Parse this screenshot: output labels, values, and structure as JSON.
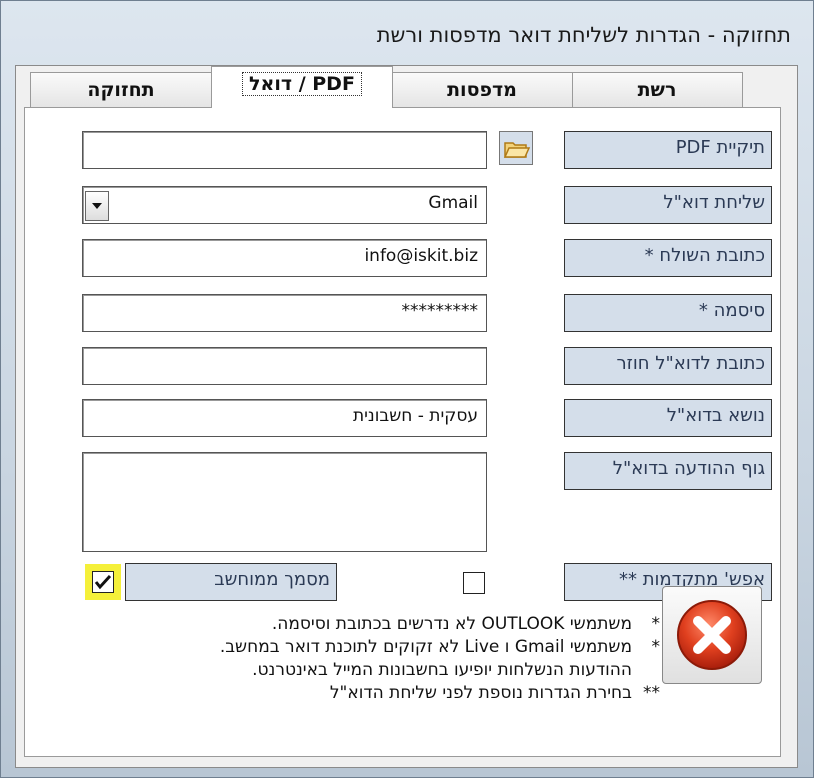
{
  "window": {
    "title": "תחזוקה - הגדרות לשליחת דואר מדפסות ורשת"
  },
  "tabs": [
    {
      "label": "רשת"
    },
    {
      "label": "מדפסות"
    },
    {
      "label": "דואל / PDF"
    },
    {
      "label": "תחזוקה"
    }
  ],
  "form": {
    "pdf_folder": {
      "label": "תיקיית PDF",
      "value": ""
    },
    "email_send": {
      "label": "שליחת דוא\"ל",
      "value": "Gmail"
    },
    "sender_address": {
      "label": "כתובת השולח *",
      "value": "info@iskit.biz"
    },
    "password": {
      "label": "סיסמה *",
      "value": "*********"
    },
    "reply_address": {
      "label": "כתובת לדוא\"ל חוזר",
      "value": ""
    },
    "subject": {
      "label": "נושא בדוא\"ל",
      "value": "עסקית - חשבונית"
    },
    "body": {
      "label": "גוף ההודעה בדוא\"ל",
      "value": ""
    },
    "advanced": {
      "label": "אפש' מתקדמות **",
      "checked": false
    },
    "computerized_doc": {
      "label": "מסמך ממוחשב",
      "checked": true
    }
  },
  "notes": [
    {
      "star": "*",
      "text": "משתמשי OUTLOOK לא נדרשים בכתובת וסיסמה."
    },
    {
      "star": "*",
      "text": "משתמשי Gmail ו Live לא זקוקים לתוכנת דואר במחשב."
    },
    {
      "star": "",
      "text": "ההודעות הנשלחות יופיעו בחשבונות המייל באינטרנט."
    },
    {
      "star": "**",
      "text": "בחירת הגדרות נוספת לפני שליחת הדוא\"ל"
    }
  ],
  "icons": {
    "folder": "folder-open-icon",
    "dropdown": "chevron-down-icon",
    "close": "close-x-icon"
  },
  "colors": {
    "label_bg": "#d4deea",
    "close_red": "#d8341c",
    "checkbox_highlight": "#f5f03a"
  }
}
